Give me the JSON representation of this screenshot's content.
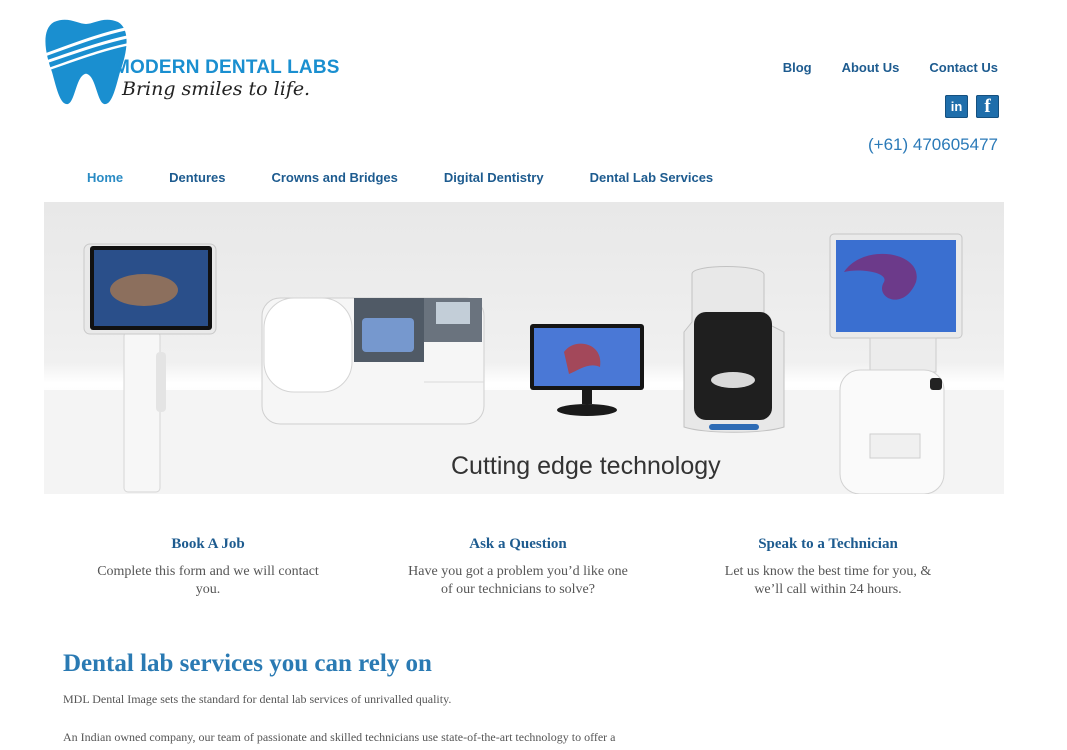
{
  "brand": {
    "name": "MODERN DENTAL LABS",
    "tagline": "Bring smiles to life.",
    "color": "#1a8fd0"
  },
  "top_nav": [
    {
      "label": "Blog"
    },
    {
      "label": "About Us"
    },
    {
      "label": "Contact Us"
    }
  ],
  "social": {
    "linkedin": "in",
    "facebook": "f"
  },
  "phone": "(+61) 470605477",
  "main_nav": [
    {
      "label": "Home",
      "active": true
    },
    {
      "label": "Dentures"
    },
    {
      "label": "Crowns and Bridges"
    },
    {
      "label": "Digital Dentistry"
    },
    {
      "label": "Dental Lab Services"
    }
  ],
  "hero": {
    "caption": "Cutting edge technology"
  },
  "features": [
    {
      "title": "Book A Job",
      "text": "Complete this form and we will contact you."
    },
    {
      "title": "Ask a Question",
      "text": "Have you got a problem you’d like one of our technicians to solve?"
    },
    {
      "title": "Speak to a Technician",
      "text": "Let us know the best time for you, & we’ll call within 24 hours."
    }
  ],
  "content": {
    "title": "Dental lab services you can rely on",
    "p1": "MDL Dental Image sets the standard for dental lab services of unrivalled quality.",
    "p2": "An Indian owned company, our team of passionate and skilled technicians use state-of-the-art technology to offer a"
  }
}
